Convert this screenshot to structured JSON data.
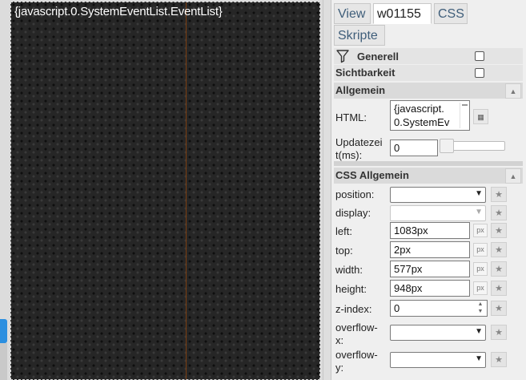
{
  "widget": {
    "content": "{javascript.0.SystemEventList.EventList}"
  },
  "tabs": {
    "view": "View",
    "widget": "w01155",
    "css": "CSS",
    "scripts": "Skripte"
  },
  "sections": {
    "general": "Generell",
    "visibility": "Sichtbarkeit",
    "common": "Allgemein",
    "css_common": "CSS Allgemein"
  },
  "fields": {
    "html": {
      "label": "HTML:",
      "value_line1": "{javascript.",
      "value_line2": "0.SystemEv"
    },
    "update_time": {
      "label_line1": "Updatezei",
      "label_line2": "t(ms):",
      "value": "0"
    },
    "position": {
      "label": "position:",
      "value": ""
    },
    "display": {
      "label": "display:",
      "value": ""
    },
    "left": {
      "label": "left:",
      "value": "1083px",
      "unit": "px"
    },
    "top": {
      "label": "top:",
      "value": "2px",
      "unit": "px"
    },
    "width": {
      "label": "width:",
      "value": "577px",
      "unit": "px"
    },
    "height": {
      "label": "height:",
      "value": "948px",
      "unit": "px"
    },
    "zindex": {
      "label": "z-index:",
      "value": "0"
    },
    "overflow_x": {
      "label_line1": "overflow-",
      "label_line2": "x:",
      "value": ""
    },
    "overflow_y": {
      "label_line1": "overflow-",
      "label_line2": "y:",
      "value": ""
    }
  },
  "colors": {
    "widget_background": "#262626",
    "divider_line": "#7a3d10",
    "left_edge_tab": "#2b8fe0"
  },
  "icons": {
    "filter": "funnel",
    "collapse": "triangle-up",
    "star": "star",
    "edit": "ellipsis"
  }
}
